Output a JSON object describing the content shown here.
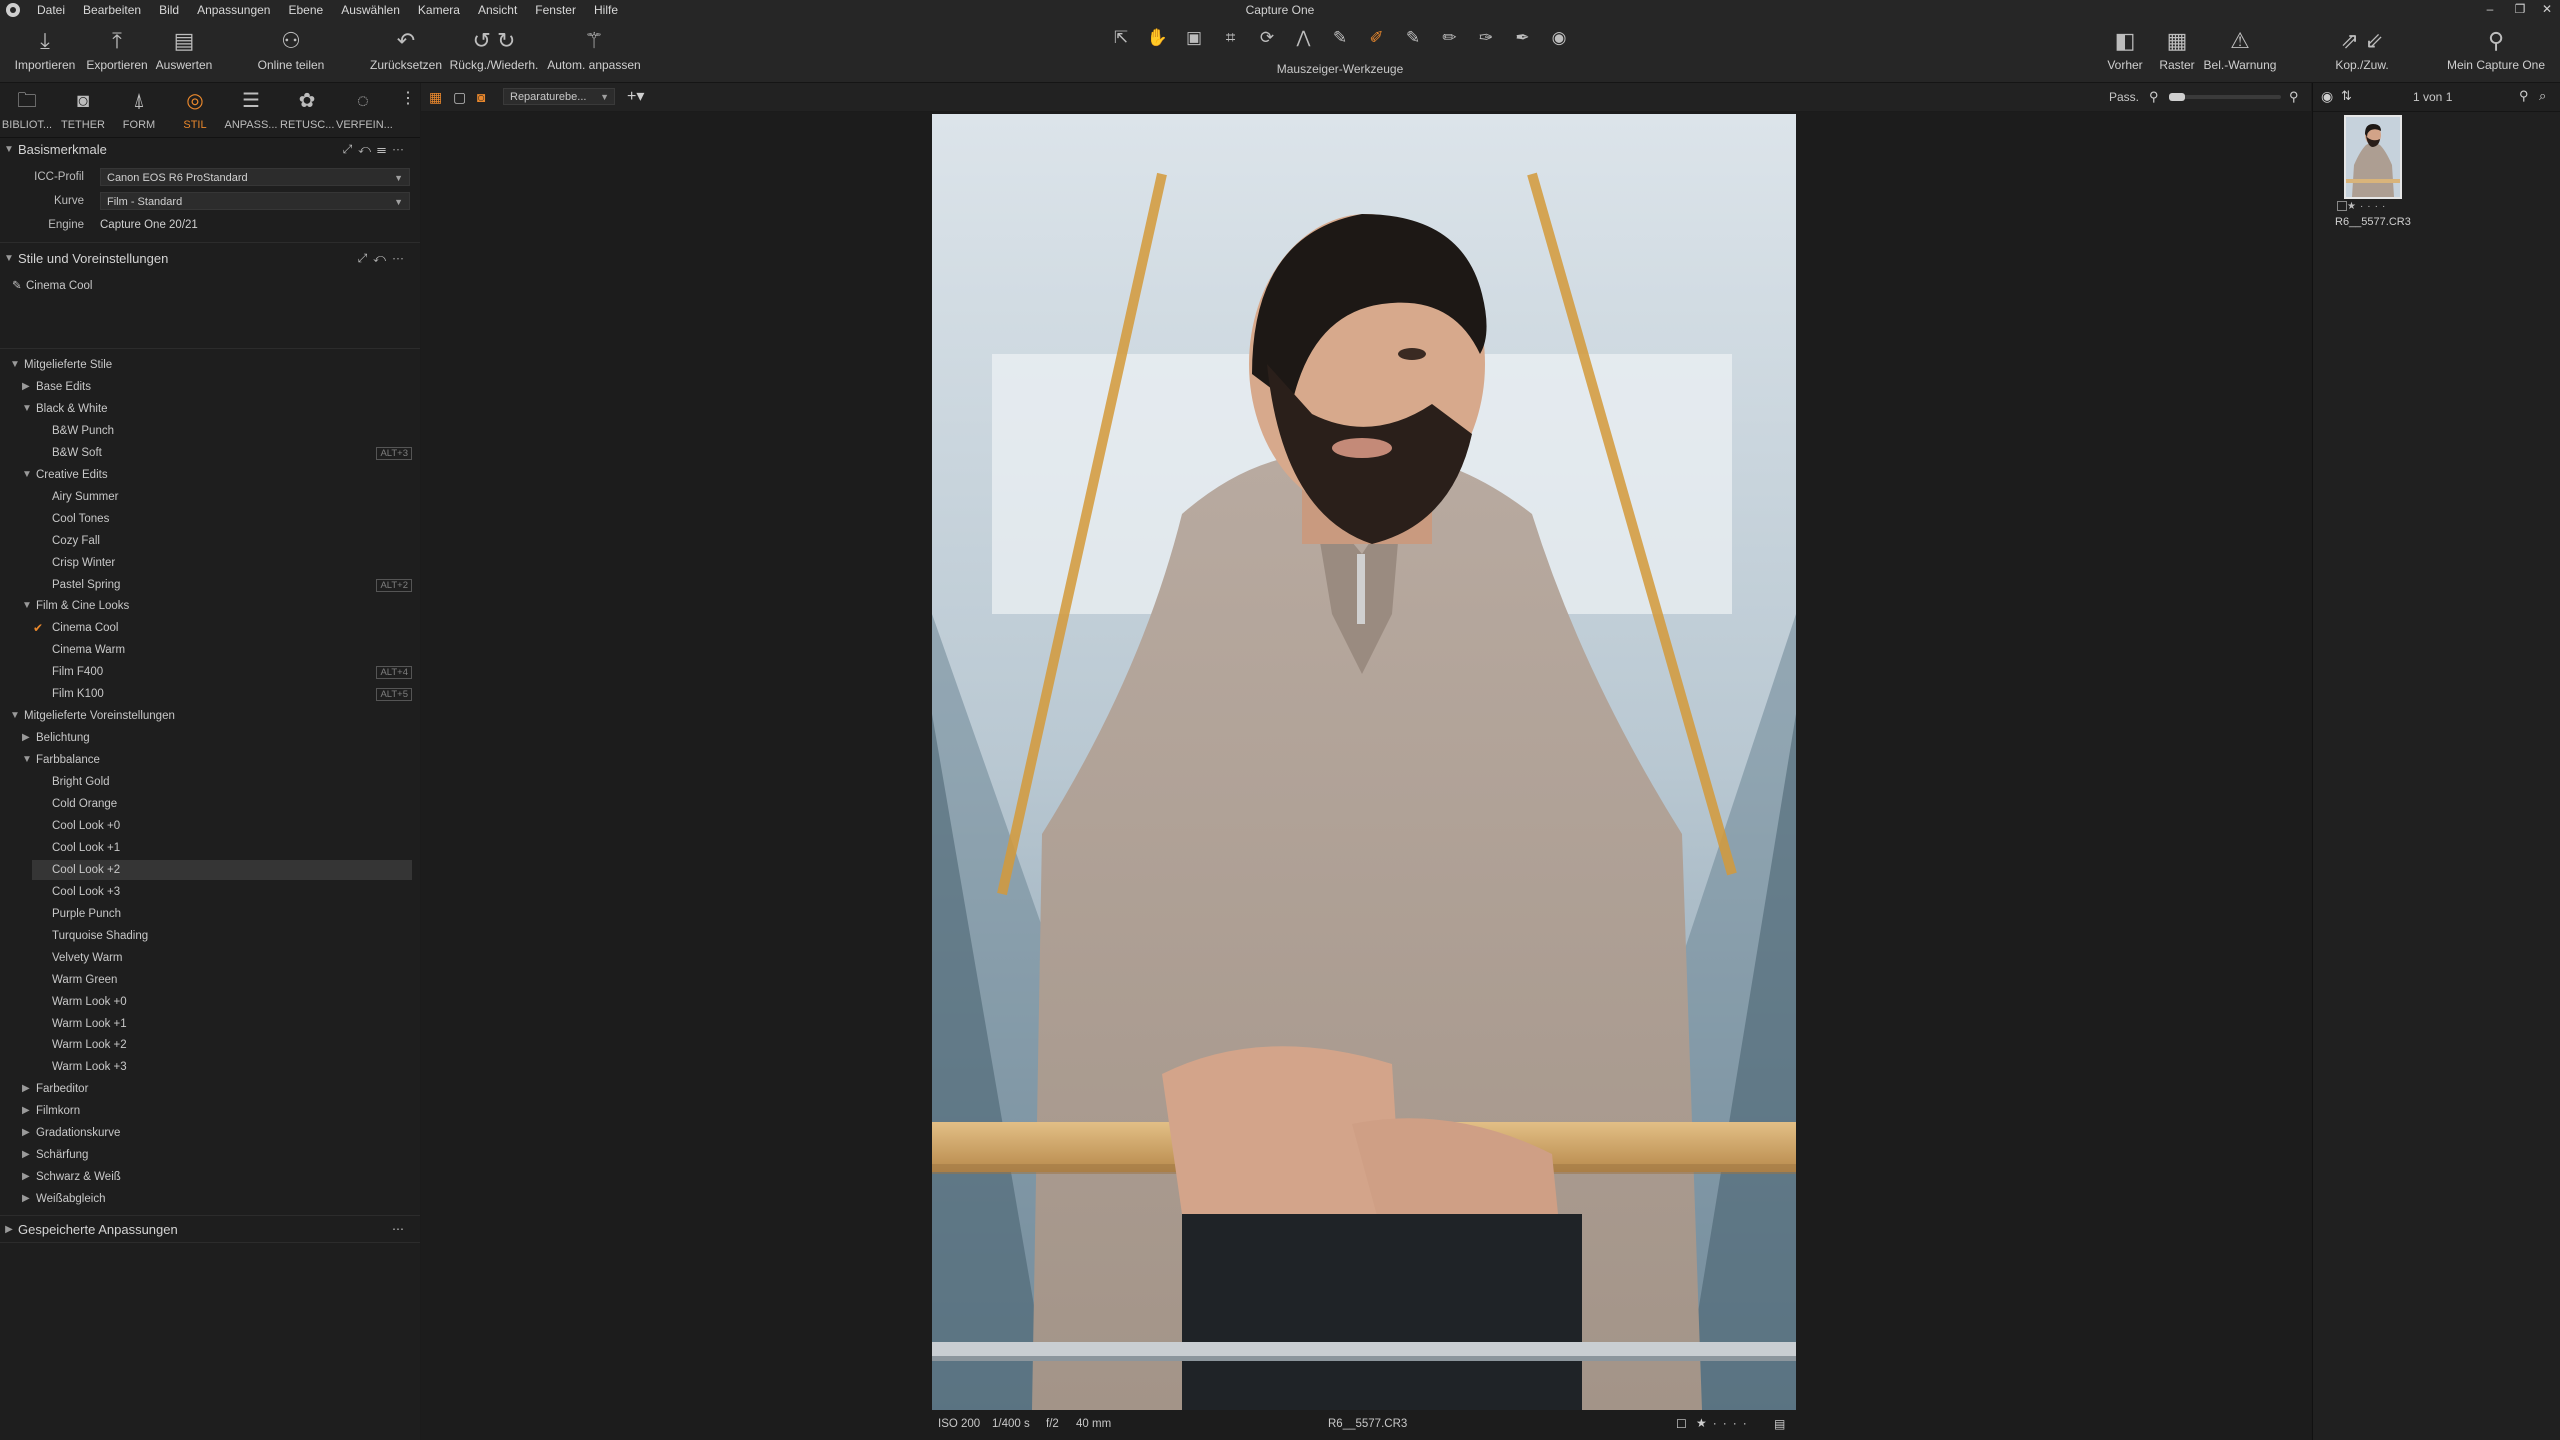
{
  "menubar": {
    "items": [
      "Datei",
      "Bearbeiten",
      "Bild",
      "Anpassungen",
      "Ebene",
      "Auswählen",
      "Kamera",
      "Ansicht",
      "Fenster",
      "Hilfe"
    ],
    "title": "Capture One",
    "controls": [
      "–",
      "❐",
      "✕"
    ]
  },
  "toolbar": {
    "import": "Importieren",
    "export": "Exportieren",
    "evaluate": "Auswerten",
    "share": "Online teilen",
    "reset": "Zurücksetzen",
    "undo_redo": "Rückg./Wiederh.",
    "auto_adjust": "Autom. anpassen",
    "cursor_tools": "Mauszeiger-Werkzeuge",
    "before": "Vorher",
    "grid": "Raster",
    "exposure_warning": "Bel.-Warnung",
    "copy_apply": "Kop./Zuw.",
    "my_capture_one": "Mein Capture One"
  },
  "tool_tabs": [
    {
      "label": "BIBLIOT...",
      "icon": "folder-icon"
    },
    {
      "label": "TETHER",
      "icon": "camera-icon"
    },
    {
      "label": "FORM",
      "icon": "lens-icon"
    },
    {
      "label": "STIL",
      "icon": "style-icon",
      "active": true
    },
    {
      "label": "ANPASS...",
      "icon": "sliders-icon"
    },
    {
      "label": "RETUSC...",
      "icon": "retouch-icon"
    },
    {
      "label": "VERFEIN...",
      "icon": "refine-icon"
    }
  ],
  "basic": {
    "header": "Basismerkmale",
    "icc_label": "ICC-Profil",
    "icc_value": "Canon EOS R6 ProStandard",
    "curve_label": "Kurve",
    "curve_value": "Film - Standard",
    "engine_label": "Engine",
    "engine_value": "Capture One 20/21"
  },
  "styles": {
    "header": "Stile und Voreinstellungen",
    "applied": "Cinema Cool"
  },
  "tree": [
    {
      "level": 0,
      "open": true,
      "text": "Mitgelieferte Stile"
    },
    {
      "level": 1,
      "open": false,
      "text": "Base Edits"
    },
    {
      "level": 1,
      "open": true,
      "text": "Black & White"
    },
    {
      "level": 2,
      "text": "B&W Punch"
    },
    {
      "level": 2,
      "text": "B&W Soft",
      "shortcut": "ALT+3"
    },
    {
      "level": 1,
      "open": true,
      "text": "Creative Edits"
    },
    {
      "level": 2,
      "text": "Airy Summer"
    },
    {
      "level": 2,
      "text": "Cool Tones"
    },
    {
      "level": 2,
      "text": "Cozy Fall"
    },
    {
      "level": 2,
      "text": "Crisp Winter"
    },
    {
      "level": 2,
      "text": "Pastel Spring",
      "shortcut": "ALT+2"
    },
    {
      "level": 1,
      "open": true,
      "text": "Film & Cine Looks"
    },
    {
      "level": 2,
      "text": "Cinema Cool",
      "checked": true
    },
    {
      "level": 2,
      "text": "Cinema Warm"
    },
    {
      "level": 2,
      "text": "Film F400",
      "shortcut": "ALT+4"
    },
    {
      "level": 2,
      "text": "Film K100",
      "shortcut": "ALT+5"
    },
    {
      "level": 0,
      "open": true,
      "text": "Mitgelieferte Voreinstellungen"
    },
    {
      "level": 1,
      "open": false,
      "text": "Belichtung"
    },
    {
      "level": 1,
      "open": true,
      "text": "Farbbalance"
    },
    {
      "level": 2,
      "text": "Bright Gold"
    },
    {
      "level": 2,
      "text": "Cold Orange"
    },
    {
      "level": 2,
      "text": "Cool Look +0"
    },
    {
      "level": 2,
      "text": "Cool Look +1"
    },
    {
      "level": 2,
      "text": "Cool Look +2",
      "selected": true
    },
    {
      "level": 2,
      "text": "Cool Look +3"
    },
    {
      "level": 2,
      "text": "Purple Punch"
    },
    {
      "level": 2,
      "text": "Turquoise Shading"
    },
    {
      "level": 2,
      "text": "Velvety Warm"
    },
    {
      "level": 2,
      "text": "Warm Green"
    },
    {
      "level": 2,
      "text": "Warm Look +0"
    },
    {
      "level": 2,
      "text": "Warm Look +1"
    },
    {
      "level": 2,
      "text": "Warm Look +2"
    },
    {
      "level": 2,
      "text": "Warm Look +3"
    },
    {
      "level": 1,
      "open": false,
      "text": "Farbeditor"
    },
    {
      "level": 1,
      "open": false,
      "text": "Filmkorn"
    },
    {
      "level": 1,
      "open": false,
      "text": "Gradationskurve"
    },
    {
      "level": 1,
      "open": false,
      "text": "Schärfung"
    },
    {
      "level": 1,
      "open": false,
      "text": "Schwarz & Weiß"
    },
    {
      "level": 1,
      "open": false,
      "text": "Weißabgleich"
    }
  ],
  "saved": {
    "header": "Gespeicherte Anpassungen"
  },
  "viewer": {
    "layer_select": "Reparaturebe...",
    "fit_label": "Pass.",
    "counter": "1 von 1"
  },
  "photo_meta": {
    "iso": "ISO 200",
    "shutter": "1/400 s",
    "aperture": "f/2",
    "focal": "40 mm",
    "filename": "R6__5577.CR3"
  },
  "browser": {
    "thumb_filename": "R6__5577.CR3"
  },
  "colors": {
    "accent": "#e8872c",
    "bg": "#1b1b1b",
    "panel": "#1e1e1e"
  }
}
